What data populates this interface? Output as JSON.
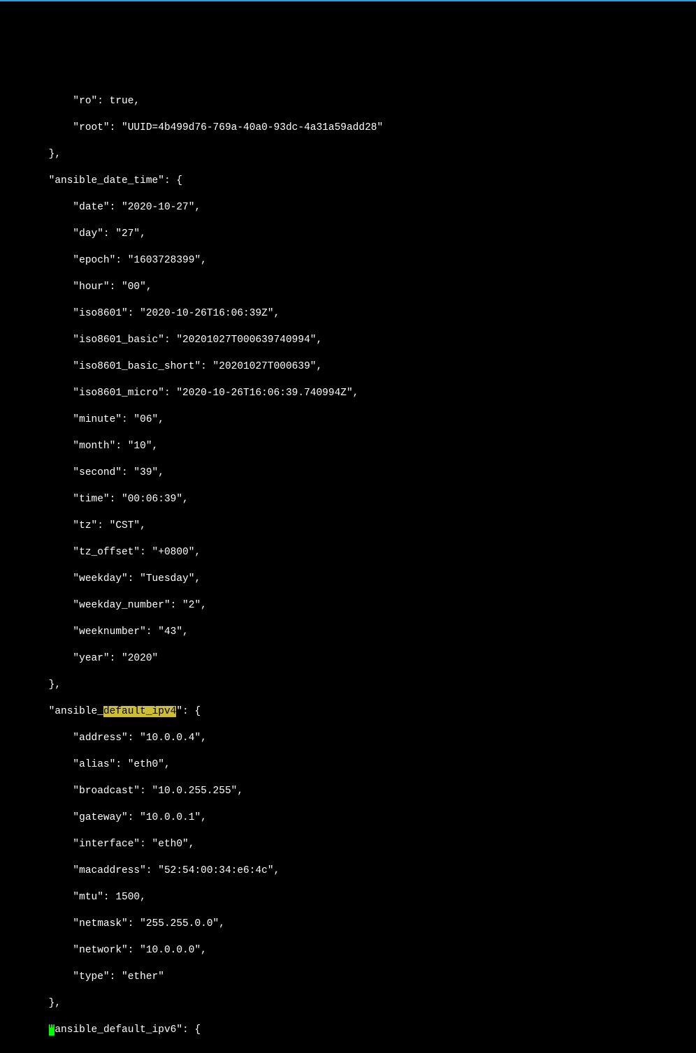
{
  "highlight_text": "default_ipv4",
  "lines": {
    "l01": "            \"ro\": true,",
    "l02": "            \"root\": \"UUID=4b499d76-769a-40a0-93dc-4a31a59add28\"",
    "l03": "        },",
    "l04": "        \"ansible_date_time\": {",
    "l05": "            \"date\": \"2020-10-27\",",
    "l06": "            \"day\": \"27\",",
    "l07": "            \"epoch\": \"1603728399\",",
    "l08": "            \"hour\": \"00\",",
    "l09": "            \"iso8601\": \"2020-10-26T16:06:39Z\",",
    "l10": "            \"iso8601_basic\": \"20201027T000639740994\",",
    "l11": "            \"iso8601_basic_short\": \"20201027T000639\",",
    "l12": "            \"iso8601_micro\": \"2020-10-26T16:06:39.740994Z\",",
    "l13": "            \"minute\": \"06\",",
    "l14": "            \"month\": \"10\",",
    "l15": "            \"second\": \"39\",",
    "l16": "            \"time\": \"00:06:39\",",
    "l17": "            \"tz\": \"CST\",",
    "l18": "            \"tz_offset\": \"+0800\",",
    "l19": "            \"weekday\": \"Tuesday\",",
    "l20": "            \"weekday_number\": \"2\",",
    "l21": "            \"weeknumber\": \"43\",",
    "l22": "            \"year\": \"2020\"",
    "l23": "        },",
    "l24a": "        \"ansible_",
    "l24b": "\": {",
    "l25": "            \"address\": \"10.0.0.4\",",
    "l26": "            \"alias\": \"eth0\",",
    "l27": "            \"broadcast\": \"10.0.255.255\",",
    "l28": "            \"gateway\": \"10.0.0.1\",",
    "l29": "            \"interface\": \"eth0\",",
    "l30": "            \"macaddress\": \"52:54:00:34:e6:4c\",",
    "l31": "            \"mtu\": 1500,",
    "l32": "            \"netmask\": \"255.255.0.0\",",
    "l33": "            \"network\": \"10.0.0.0\",",
    "l34": "            \"type\": \"ether\"",
    "l35": "        },",
    "l36a": "        ",
    "l36b": "ansible_default_ipv6\": {",
    "cursor_char": "\""
  }
}
